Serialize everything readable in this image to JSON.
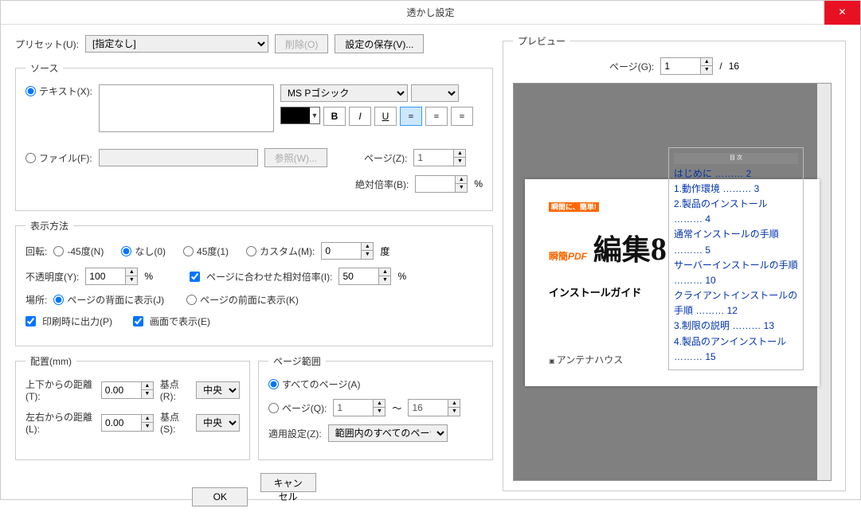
{
  "title": "透かし設定",
  "preset": {
    "label": "プリセット(U):",
    "value": "[指定なし]",
    "delete": "削除(O)",
    "save": "設定の保存(V)..."
  },
  "source": {
    "legend": "ソース",
    "text_label": "テキスト(X):",
    "file_label": "ファイル(F):",
    "browse": "参照(W)...",
    "page_label": "ページ(Z):",
    "page_value": "1",
    "scale_label": "絶対倍率(B):",
    "scale_unit": "%",
    "font": "MS Pゴシック"
  },
  "display": {
    "legend": "表示方法",
    "rotation_label": "回転:",
    "rotation_options": {
      "n45": "-45度(N)",
      "none": "なし(0)",
      "p45": "45度(1)",
      "custom": "カスタム(M):"
    },
    "rotation_value": "0",
    "rotation_unit": "度",
    "opacity_label": "不透明度(Y):",
    "opacity_value": "100",
    "opacity_unit": "%",
    "relative_scale_cb": "ページに合わせた相対倍率(I):",
    "relative_scale_value": "50",
    "relative_scale_unit": "%",
    "location_label": "場所:",
    "loc_behind": "ページの背面に表示(J)",
    "loc_front": "ページの前面に表示(K)",
    "print_cb": "印刷時に出力(P)",
    "screen_cb": "画面で表示(E)"
  },
  "position": {
    "legend": "配置(mm)",
    "top_label": "上下からの距離(T):",
    "top_value": "0.00",
    "left_label": "左右からの距離(L):",
    "left_value": "0.00",
    "origin_r_label": "基点(R):",
    "origin_r_value": "中央",
    "origin_s_label": "基点(S):",
    "origin_s_value": "中央"
  },
  "range": {
    "legend": "ページ範囲",
    "all": "すべてのページ(A)",
    "pages_label": "ページ(Q):",
    "from": "1",
    "to_sep": "～",
    "to": "16",
    "apply_label": "適用設定(Z):",
    "apply_value": "範囲内のすべてのページ"
  },
  "preview": {
    "legend": "プレビュー",
    "page_label": "ページ(G):",
    "page_value": "1",
    "sep": "/",
    "total": "16",
    "doc_title_1": "瞬簡",
    "doc_title_2": "PDF",
    "doc_title_3": "編集",
    "doc_title_4": "8",
    "sub": "インストールガイド",
    "toc_hdr": "目 次",
    "toc": [
      "はじめに ……… 2",
      "1.動作環境 ……… 3",
      "2.製品のインストール ……… 4",
      "通常インストールの手順 ……… 5",
      "サーバーインストールの手順 ……… 10",
      "クライアントインストールの手順 ……… 12",
      "3.制限の説明 ……… 13",
      "4.製品のアンインストール ……… 15"
    ],
    "brand": "アンテナハウス"
  },
  "actions": {
    "ok": "OK",
    "cancel": "キャンセル"
  }
}
